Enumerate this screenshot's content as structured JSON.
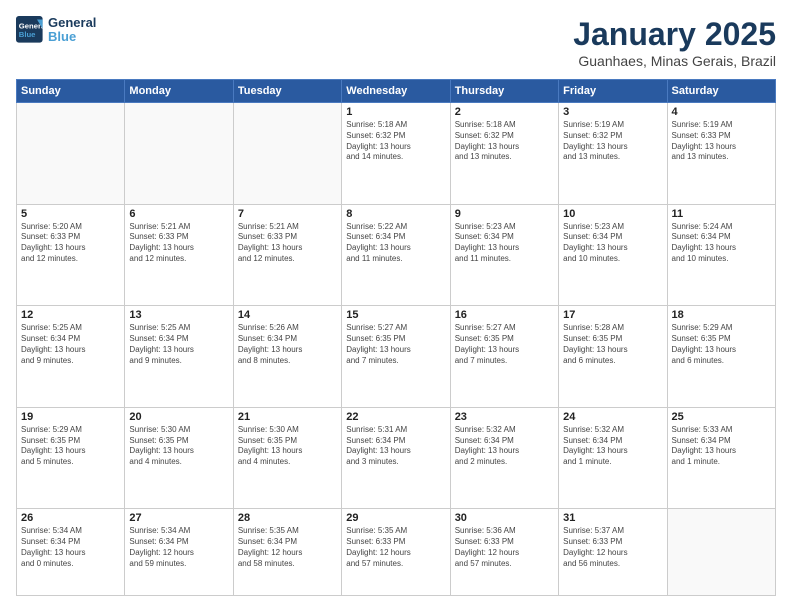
{
  "logo": {
    "line1": "General",
    "line2": "Blue"
  },
  "header": {
    "month": "January 2025",
    "location": "Guanhaes, Minas Gerais, Brazil"
  },
  "weekdays": [
    "Sunday",
    "Monday",
    "Tuesday",
    "Wednesday",
    "Thursday",
    "Friday",
    "Saturday"
  ],
  "weeks": [
    [
      {
        "day": "",
        "info": ""
      },
      {
        "day": "",
        "info": ""
      },
      {
        "day": "",
        "info": ""
      },
      {
        "day": "1",
        "info": "Sunrise: 5:18 AM\nSunset: 6:32 PM\nDaylight: 13 hours\nand 14 minutes."
      },
      {
        "day": "2",
        "info": "Sunrise: 5:18 AM\nSunset: 6:32 PM\nDaylight: 13 hours\nand 13 minutes."
      },
      {
        "day": "3",
        "info": "Sunrise: 5:19 AM\nSunset: 6:32 PM\nDaylight: 13 hours\nand 13 minutes."
      },
      {
        "day": "4",
        "info": "Sunrise: 5:19 AM\nSunset: 6:33 PM\nDaylight: 13 hours\nand 13 minutes."
      }
    ],
    [
      {
        "day": "5",
        "info": "Sunrise: 5:20 AM\nSunset: 6:33 PM\nDaylight: 13 hours\nand 12 minutes."
      },
      {
        "day": "6",
        "info": "Sunrise: 5:21 AM\nSunset: 6:33 PM\nDaylight: 13 hours\nand 12 minutes."
      },
      {
        "day": "7",
        "info": "Sunrise: 5:21 AM\nSunset: 6:33 PM\nDaylight: 13 hours\nand 12 minutes."
      },
      {
        "day": "8",
        "info": "Sunrise: 5:22 AM\nSunset: 6:34 PM\nDaylight: 13 hours\nand 11 minutes."
      },
      {
        "day": "9",
        "info": "Sunrise: 5:23 AM\nSunset: 6:34 PM\nDaylight: 13 hours\nand 11 minutes."
      },
      {
        "day": "10",
        "info": "Sunrise: 5:23 AM\nSunset: 6:34 PM\nDaylight: 13 hours\nand 10 minutes."
      },
      {
        "day": "11",
        "info": "Sunrise: 5:24 AM\nSunset: 6:34 PM\nDaylight: 13 hours\nand 10 minutes."
      }
    ],
    [
      {
        "day": "12",
        "info": "Sunrise: 5:25 AM\nSunset: 6:34 PM\nDaylight: 13 hours\nand 9 minutes."
      },
      {
        "day": "13",
        "info": "Sunrise: 5:25 AM\nSunset: 6:34 PM\nDaylight: 13 hours\nand 9 minutes."
      },
      {
        "day": "14",
        "info": "Sunrise: 5:26 AM\nSunset: 6:34 PM\nDaylight: 13 hours\nand 8 minutes."
      },
      {
        "day": "15",
        "info": "Sunrise: 5:27 AM\nSunset: 6:35 PM\nDaylight: 13 hours\nand 7 minutes."
      },
      {
        "day": "16",
        "info": "Sunrise: 5:27 AM\nSunset: 6:35 PM\nDaylight: 13 hours\nand 7 minutes."
      },
      {
        "day": "17",
        "info": "Sunrise: 5:28 AM\nSunset: 6:35 PM\nDaylight: 13 hours\nand 6 minutes."
      },
      {
        "day": "18",
        "info": "Sunrise: 5:29 AM\nSunset: 6:35 PM\nDaylight: 13 hours\nand 6 minutes."
      }
    ],
    [
      {
        "day": "19",
        "info": "Sunrise: 5:29 AM\nSunset: 6:35 PM\nDaylight: 13 hours\nand 5 minutes."
      },
      {
        "day": "20",
        "info": "Sunrise: 5:30 AM\nSunset: 6:35 PM\nDaylight: 13 hours\nand 4 minutes."
      },
      {
        "day": "21",
        "info": "Sunrise: 5:30 AM\nSunset: 6:35 PM\nDaylight: 13 hours\nand 4 minutes."
      },
      {
        "day": "22",
        "info": "Sunrise: 5:31 AM\nSunset: 6:34 PM\nDaylight: 13 hours\nand 3 minutes."
      },
      {
        "day": "23",
        "info": "Sunrise: 5:32 AM\nSunset: 6:34 PM\nDaylight: 13 hours\nand 2 minutes."
      },
      {
        "day": "24",
        "info": "Sunrise: 5:32 AM\nSunset: 6:34 PM\nDaylight: 13 hours\nand 1 minute."
      },
      {
        "day": "25",
        "info": "Sunrise: 5:33 AM\nSunset: 6:34 PM\nDaylight: 13 hours\nand 1 minute."
      }
    ],
    [
      {
        "day": "26",
        "info": "Sunrise: 5:34 AM\nSunset: 6:34 PM\nDaylight: 13 hours\nand 0 minutes."
      },
      {
        "day": "27",
        "info": "Sunrise: 5:34 AM\nSunset: 6:34 PM\nDaylight: 12 hours\nand 59 minutes."
      },
      {
        "day": "28",
        "info": "Sunrise: 5:35 AM\nSunset: 6:34 PM\nDaylight: 12 hours\nand 58 minutes."
      },
      {
        "day": "29",
        "info": "Sunrise: 5:35 AM\nSunset: 6:33 PM\nDaylight: 12 hours\nand 57 minutes."
      },
      {
        "day": "30",
        "info": "Sunrise: 5:36 AM\nSunset: 6:33 PM\nDaylight: 12 hours\nand 57 minutes."
      },
      {
        "day": "31",
        "info": "Sunrise: 5:37 AM\nSunset: 6:33 PM\nDaylight: 12 hours\nand 56 minutes."
      },
      {
        "day": "",
        "info": ""
      }
    ]
  ]
}
